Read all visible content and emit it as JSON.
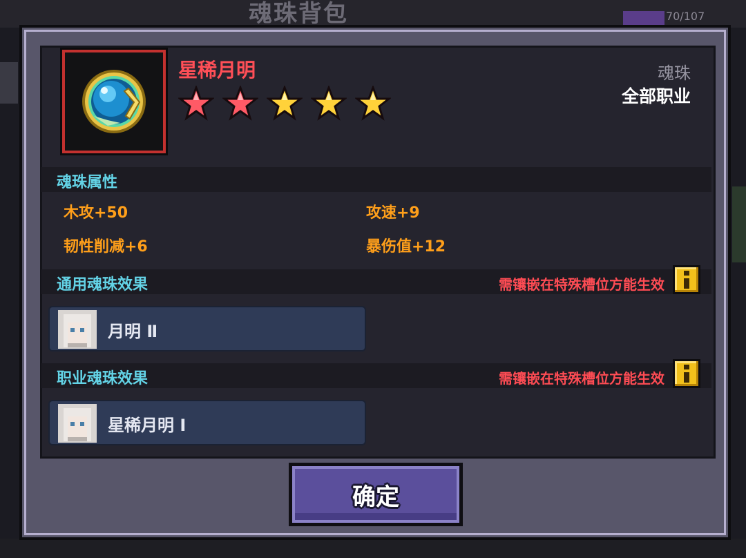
{
  "background": {
    "title": "魂珠背包",
    "count": "70/107"
  },
  "item": {
    "name": "星稀月明",
    "type": "魂珠",
    "job": "全部职业",
    "stars": [
      "red",
      "red",
      "gold",
      "gold",
      "gold"
    ],
    "icon": "blue-orb-icon"
  },
  "attributes": {
    "title": "魂珠属性",
    "stats": [
      "木攻+50",
      "攻速+9",
      "韧性削减+6",
      "暴伤值+12"
    ]
  },
  "general_effect": {
    "title": "通用魂珠效果",
    "warning": "需镶嵌在特殊槽位方能生效",
    "entry": "月明 Ⅱ"
  },
  "job_effect": {
    "title": "职业魂珠效果",
    "warning": "需镶嵌在特殊槽位方能生效",
    "entry": "星稀月明 Ⅰ"
  },
  "confirm_label": "确定",
  "colors": {
    "name_red": "#ff4f57",
    "section_cyan": "#63d3e6",
    "stat_orange": "#ff9f1a",
    "warning_red": "#ff4c54",
    "info_yellow": "#f2c01b",
    "button_purple": "#5b4f9c"
  }
}
